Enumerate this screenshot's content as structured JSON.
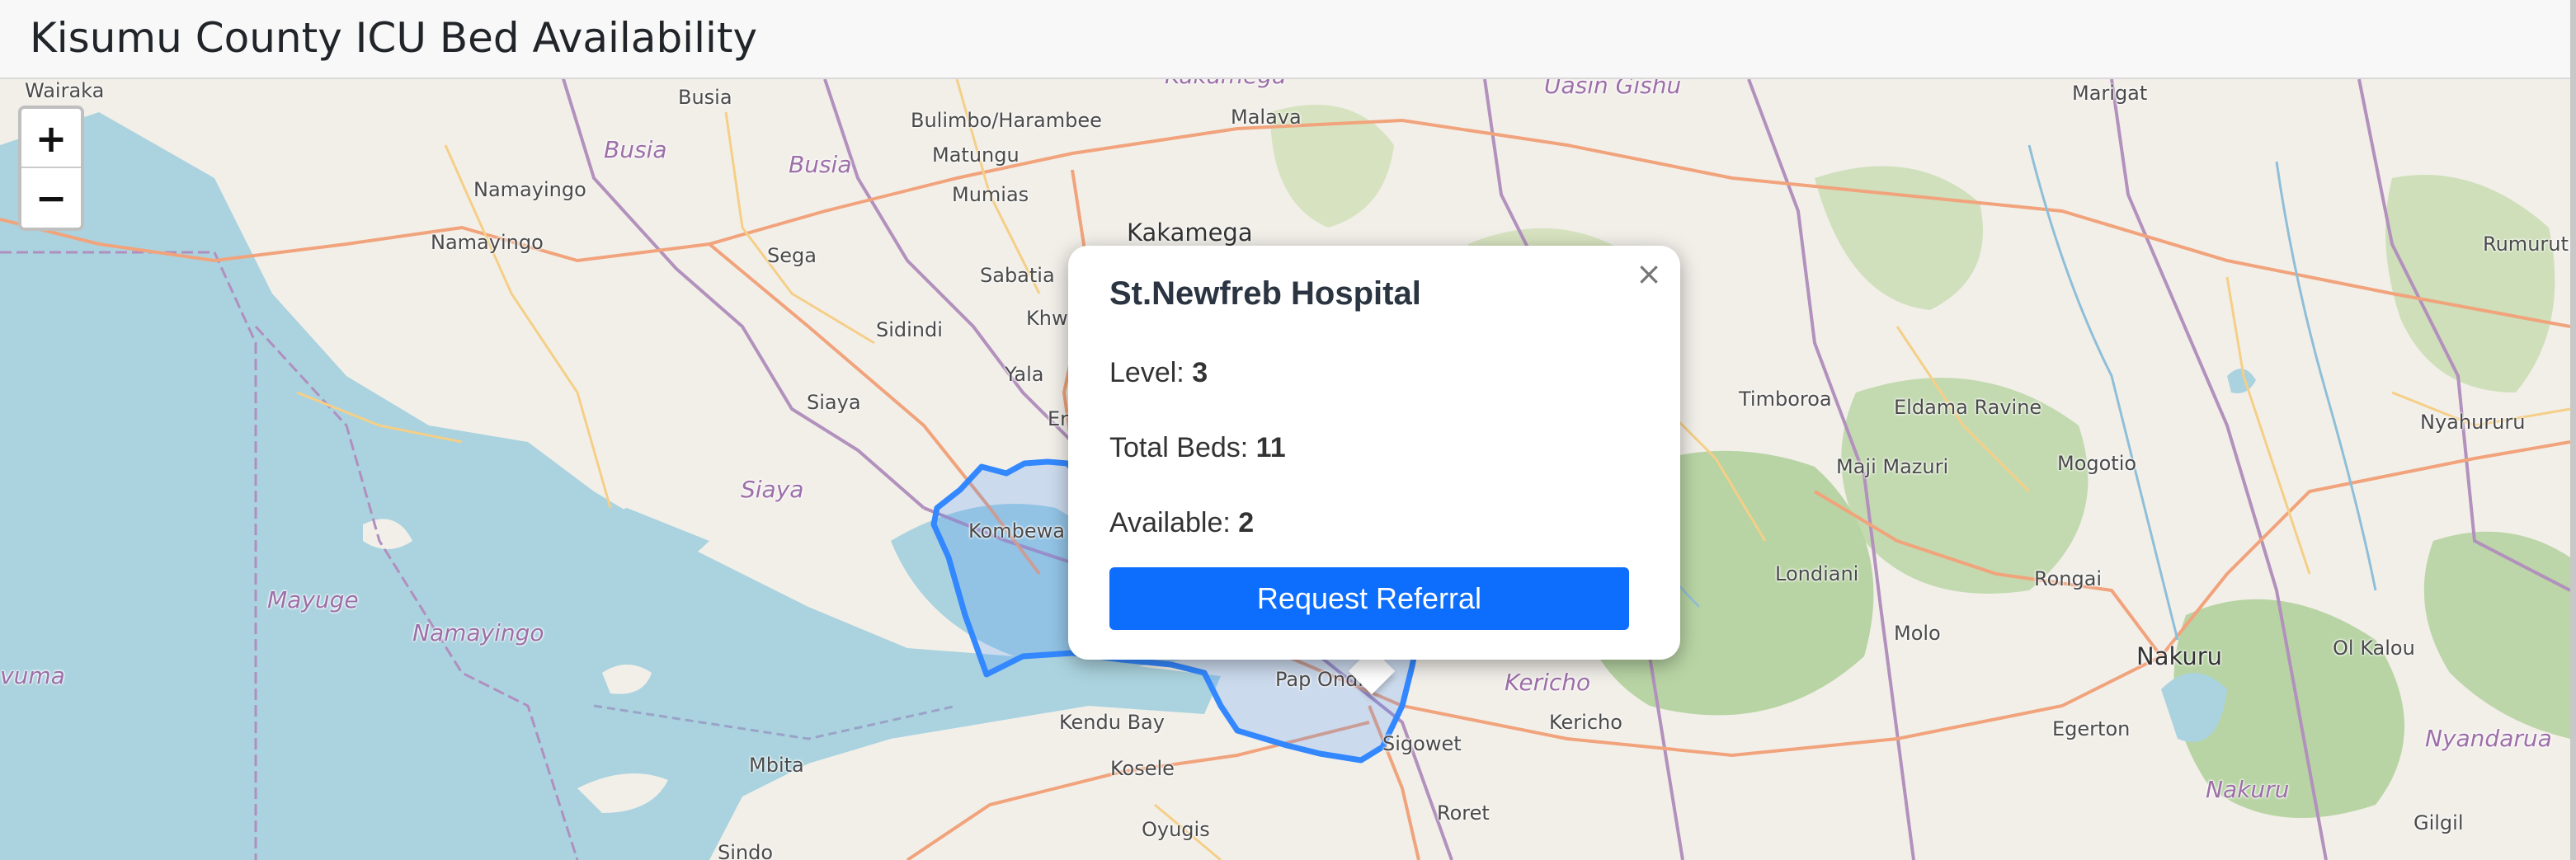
{
  "page": {
    "title": "Kisumu County ICU Bed Availability"
  },
  "map": {
    "zoom_in_label": "+",
    "zoom_out_label": "−",
    "colors": {
      "land": "#f2efe9",
      "water": "#aad3df",
      "forest": "#aecf98",
      "boundary": "#9d6fa8",
      "primary_road": "#f1a37c",
      "secondary_road": "#f5cf87",
      "county_outline": "#3388ff",
      "county_fill": "#3388ff"
    },
    "place_labels": {
      "wairaka": "Wairaka",
      "busia_town": "Busia",
      "bulimbo": "Bulimbo/Harambee",
      "malava": "Malava",
      "kakamega_top": "Kakamega",
      "uasin_gishu": "Uasin Gishu",
      "marigat": "Marigat",
      "namayingo_1": "Namayingo",
      "busia_admin_1": "Busia",
      "busia_admin_2": "Busia",
      "matungu": "Matungu",
      "mumias": "Mumias",
      "rumuruti": "Rumuruti",
      "namayingo_2": "Namayingo",
      "sega": "Sega",
      "kakamega": "Kakamega",
      "sabatia": "Sabatia",
      "khw": "Khw",
      "sidindi": "Sidindi",
      "yala": "Yala",
      "siaya": "Siaya",
      "er": "Er",
      "timboroa": "Timboroa",
      "eldama_ravine": "Eldama Ravine",
      "nyahururu": "Nyahururu",
      "maji_mazuri": "Maji Mazuri",
      "mogotio": "Mogotio",
      "siaya_admin": "Siaya",
      "kombewa": "Kombewa",
      "londiani": "Londiani",
      "rongai": "Rongai",
      "mayuge": "Mayuge",
      "namayingo_admin": "Namayingo",
      "molo": "Molo",
      "ol_kalou": "Ol Kalou",
      "nakuru": "Nakuru",
      "vuma": "vuma",
      "pap_onditi": "Pap Onditi",
      "kericho_admin": "Kericho",
      "kendu_bay": "Kendu Bay",
      "kericho": "Kericho",
      "egerton": "Egerton",
      "sigowet": "Sigowet",
      "nyandarua": "Nyandarua",
      "mbita": "Mbita",
      "kosele": "Kosele",
      "nakuru_admin": "Nakuru",
      "roret": "Roret",
      "gilgil": "Gilgil",
      "oyugis": "Oyugis",
      "sindo": "Sindo"
    }
  },
  "popup": {
    "close_label": "×",
    "hospital_name": "St.Newfreb Hospital",
    "level_label": "Level:",
    "level_value": "3",
    "total_beds_label": "Total Beds:",
    "total_beds_value": "11",
    "available_label": "Available:",
    "available_value": "2",
    "referral_button_label": "Request Referral"
  }
}
